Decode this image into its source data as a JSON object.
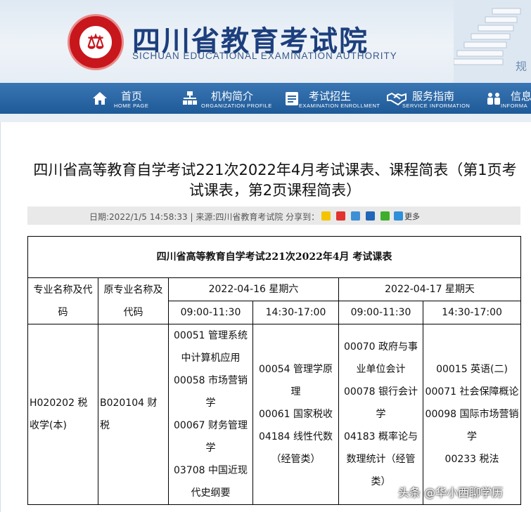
{
  "site": {
    "title": "四川省教育考试院",
    "subtitle": "SICHUAN EDUCATIONAL EXAMINATION AUTHORITY",
    "brand_color": "#1d3f7d",
    "logo_color": "#c8161d"
  },
  "nav": {
    "items": [
      {
        "zh": "首页",
        "en": "HOME PAGE",
        "icon": "home-icon"
      },
      {
        "zh": "机构简介",
        "en": "ORGANIZATION PROFILE",
        "icon": "org-chart-icon"
      },
      {
        "zh": "考试招生",
        "en": "EXAMINATION ENROLLMENT",
        "icon": "document-list-icon"
      },
      {
        "zh": "服务指南",
        "en": "SERVICE INFORMATION",
        "icon": "handshake-icon"
      },
      {
        "zh": "信息",
        "en": "INFORMA",
        "icon": "people-icon"
      }
    ],
    "bg_color": "#2a67a6"
  },
  "article": {
    "title": "四川省高等教育自学考试221次2022年4月考试课表、课程简表（第1页考试课表，第2页课程简表）",
    "meta": "日期:2022/1/5 14:58:33 | 来源:四川省教育考试院   分享到：",
    "share_more": "更多"
  },
  "table": {
    "title": "四川省高等教育自学考试221次2022年4月  考试课表",
    "col_major": "专业名称及代码",
    "col_old_major": "原专业名称及代码",
    "date1": "2022-04-16 星期六",
    "date2": "2022-04-17 星期天",
    "slot_am": "09:00-11:30",
    "slot_pm": "14:30-17:00",
    "row": {
      "major": "H020202 税收学(本)",
      "old_major": "B020104 财税",
      "d1_am": [
        "00051 管理系统中计算机应用",
        "00058 市场营销学",
        "00067 财务管理学",
        "03708 中国近现代史纲要"
      ],
      "d1_pm": [
        "00054 管理学原理",
        "00061 国家税收",
        "04184 线性代数（经管类）"
      ],
      "d2_am": [
        "00070 政府与事业单位会计",
        "00078 银行会计学",
        "04183 概率论与数理统计（经管类）"
      ],
      "d2_pm": [
        "00015 英语(二)",
        "00071 社会保障概论",
        "00098 国际市场营销学",
        "00233 税法"
      ]
    }
  },
  "watermark": "头条 @华小西聊学历"
}
